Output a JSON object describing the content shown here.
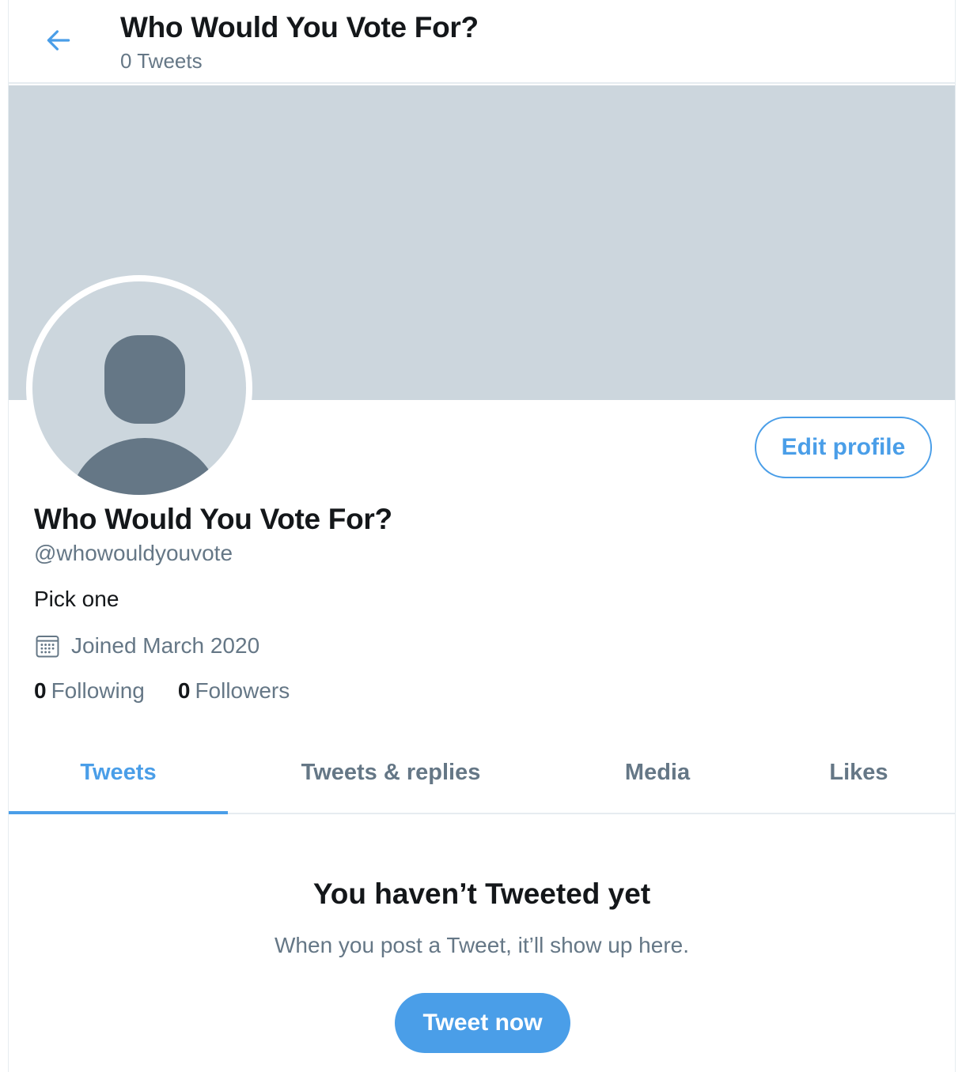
{
  "header": {
    "title": "Who Would You Vote For?",
    "tweet_count": "0 Tweets"
  },
  "profile": {
    "name": "Who Would You Vote For?",
    "handle": "@whowouldyouvote",
    "bio": "Pick one",
    "joined": "Joined March 2020",
    "following_count": "0",
    "following_label": "Following",
    "followers_count": "0",
    "followers_label": "Followers",
    "edit_button": "Edit profile"
  },
  "tabs": [
    {
      "label": "Tweets",
      "active": true
    },
    {
      "label": "Tweets & replies",
      "active": false
    },
    {
      "label": "Media",
      "active": false
    },
    {
      "label": "Likes",
      "active": false
    }
  ],
  "empty_state": {
    "title": "You haven’t Tweeted yet",
    "subtitle": "When you post a Tweet, it’ll show up here.",
    "button": "Tweet now"
  },
  "icons": {
    "back": "arrow-left-icon",
    "avatar": "default-avatar-icon",
    "calendar": "calendar-icon"
  },
  "colors": {
    "accent": "#4a9ee8",
    "banner": "#ccd6dd",
    "secondary_text": "#657786",
    "primary_text": "#14171a"
  }
}
